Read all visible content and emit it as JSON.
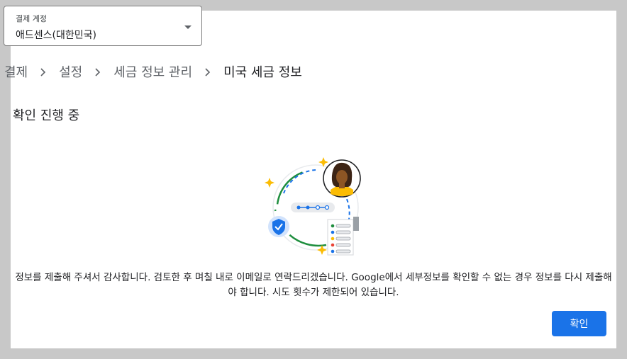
{
  "account": {
    "label": "결제 계정",
    "value": "애드센스(대한민국)"
  },
  "breadcrumb": {
    "items": [
      "결제",
      "설정",
      "세금 정보 관리"
    ],
    "current": "미국 세금 정보"
  },
  "status": {
    "title": "확인 진행 중",
    "message": "정보를 제출해 주셔서 감사합니다. 검토한 후 며칠 내로 이메일로 연락드리겠습니다. Google에서 세부정보를 확인할 수 없는 경우 정보를 다시 제출해야 합니다. 시도 횟수가 제한되어 있습니다."
  },
  "actions": {
    "confirm_label": "확인"
  },
  "colors": {
    "accent": "#1a73e8",
    "panel": "#ffffff",
    "backdrop": "#c8c8c8"
  },
  "icons": [
    "chevron-down-icon",
    "chevron-right-icon",
    "shield-check-icon",
    "sparkle-icon",
    "avatar"
  ]
}
